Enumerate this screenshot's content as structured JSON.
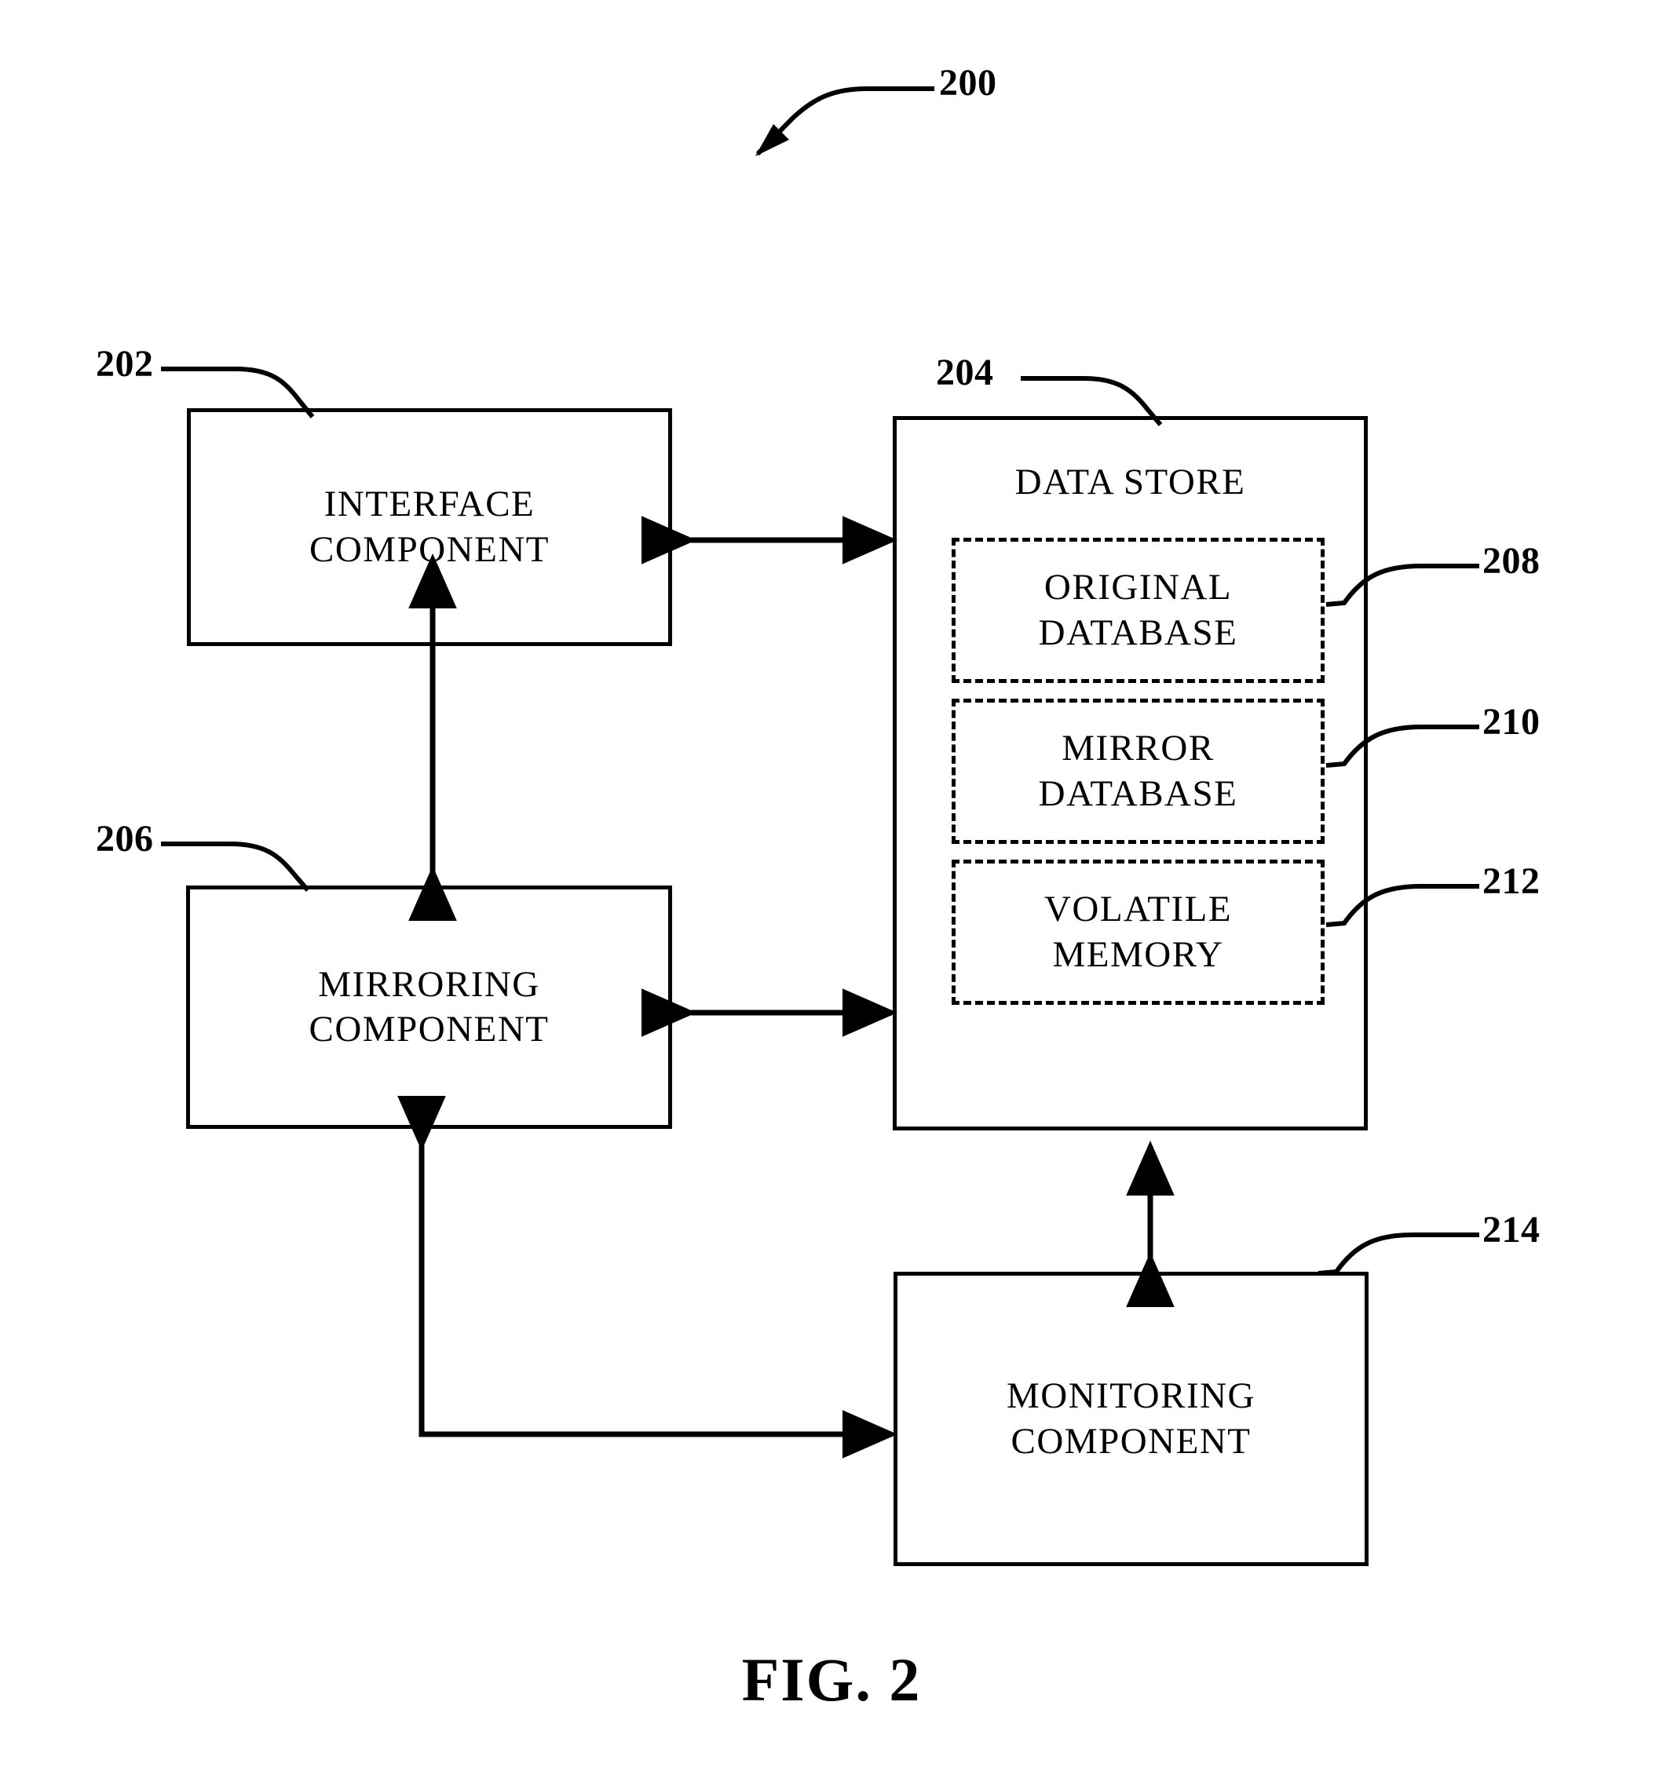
{
  "figure": {
    "caption": "FIG. 2",
    "diagram_ref": "200"
  },
  "nodes": {
    "interface_component": {
      "ref": "202",
      "label": "INTERFACE\nCOMPONENT"
    },
    "data_store": {
      "ref": "204",
      "title": "DATA STORE",
      "sub_blocks": [
        {
          "ref": "208",
          "label": "ORIGINAL\nDATABASE"
        },
        {
          "ref": "210",
          "label": "MIRROR\nDATABASE"
        },
        {
          "ref": "212",
          "label": "VOLATILE\nMEMORY"
        }
      ]
    },
    "mirroring_component": {
      "ref": "206",
      "label": "MIRRORING\nCOMPONENT"
    },
    "monitoring_component": {
      "ref": "214",
      "label": "MONITORING\nCOMPONENT"
    }
  },
  "connections": [
    {
      "from": "interface_component",
      "to": "data_store",
      "style": "bidirectional"
    },
    {
      "from": "interface_component",
      "to": "mirroring_component",
      "style": "bidirectional"
    },
    {
      "from": "mirroring_component",
      "to": "data_store",
      "style": "bidirectional"
    },
    {
      "from": "data_store",
      "to": "monitoring_component",
      "style": "bidirectional"
    },
    {
      "from": "monitoring_component",
      "to": "mirroring_component",
      "style": "bidirectional-elbow"
    }
  ],
  "colors": {
    "line": "#000000",
    "background": "#ffffff"
  }
}
